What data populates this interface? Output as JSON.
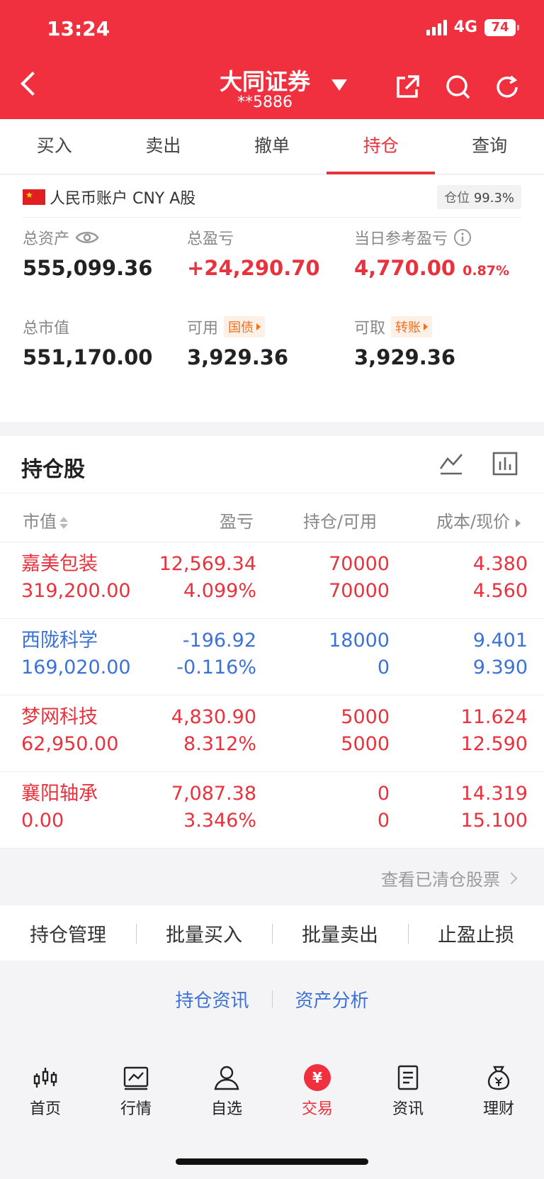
{
  "status": {
    "time": "13:24",
    "network": "4G",
    "battery": "74"
  },
  "header": {
    "broker": "大同证券",
    "account_no": "**5886"
  },
  "tabs": [
    {
      "label": "买入"
    },
    {
      "label": "卖出"
    },
    {
      "label": "撤单"
    },
    {
      "label": "持仓"
    },
    {
      "label": "查询"
    }
  ],
  "account": {
    "label": "人民币账户 CNY A股",
    "position_label": "仓位",
    "position_value": "99.3%",
    "total_assets_label": "总资产",
    "total_assets": "555,099.36",
    "total_pnl_label": "总盈亏",
    "total_pnl": "+24,290.70",
    "daily_pnl_label": "当日参考盈亏",
    "daily_pnl": "4,770.00",
    "daily_pnl_pct": "0.87%",
    "market_value_label": "总市值",
    "market_value": "551,170.00",
    "available_label": "可用",
    "available_tag": "国债",
    "available": "3,929.36",
    "withdrawable_label": "可取",
    "withdrawable_tag": "转账",
    "withdrawable": "3,929.36"
  },
  "holdings": {
    "title": "持仓股",
    "columns": {
      "market_value": "市值",
      "pnl": "盈亏",
      "position": "持仓/可用",
      "cost": "成本/现价"
    },
    "rows": [
      {
        "name": "嘉美包装",
        "value": "319,200.00",
        "pnl": "12,569.34",
        "pnl_pct": "4.099%",
        "hold": "70000",
        "avail": "70000",
        "cost": "4.380",
        "price": "4.560",
        "color": "#e8323d"
      },
      {
        "name": "西陇科学",
        "value": "169,020.00",
        "pnl": "-196.92",
        "pnl_pct": "-0.116%",
        "hold": "18000",
        "avail": "0",
        "cost": "9.401",
        "price": "9.390",
        "color": "#3c72d6"
      },
      {
        "name": "梦网科技",
        "value": "62,950.00",
        "pnl": "4,830.90",
        "pnl_pct": "8.312%",
        "hold": "5000",
        "avail": "5000",
        "cost": "11.624",
        "price": "12.590",
        "color": "#e8323d"
      },
      {
        "name": "襄阳轴承",
        "value": "0.00",
        "pnl": "7,087.38",
        "pnl_pct": "3.346%",
        "hold": "0",
        "avail": "0",
        "cost": "14.319",
        "price": "15.100",
        "color": "#e8323d"
      }
    ],
    "cleared_link": "查看已清仓股票"
  },
  "actions": [
    {
      "label": "持仓管理"
    },
    {
      "label": "批量买入"
    },
    {
      "label": "批量卖出"
    },
    {
      "label": "止盈止损"
    }
  ],
  "links": {
    "news": "持仓资讯",
    "analysis": "资产分析"
  },
  "bottom_nav": [
    {
      "label": "首页",
      "icon": "candlestick-icon"
    },
    {
      "label": "行情",
      "icon": "chart-icon"
    },
    {
      "label": "自选",
      "icon": "user-icon"
    },
    {
      "label": "交易",
      "icon": "yen-icon"
    },
    {
      "label": "资讯",
      "icon": "document-icon"
    },
    {
      "label": "理财",
      "icon": "moneybag-icon"
    }
  ],
  "colors": {
    "brand": "#f0303f",
    "up": "#e8323d",
    "down": "#3c72d6"
  }
}
